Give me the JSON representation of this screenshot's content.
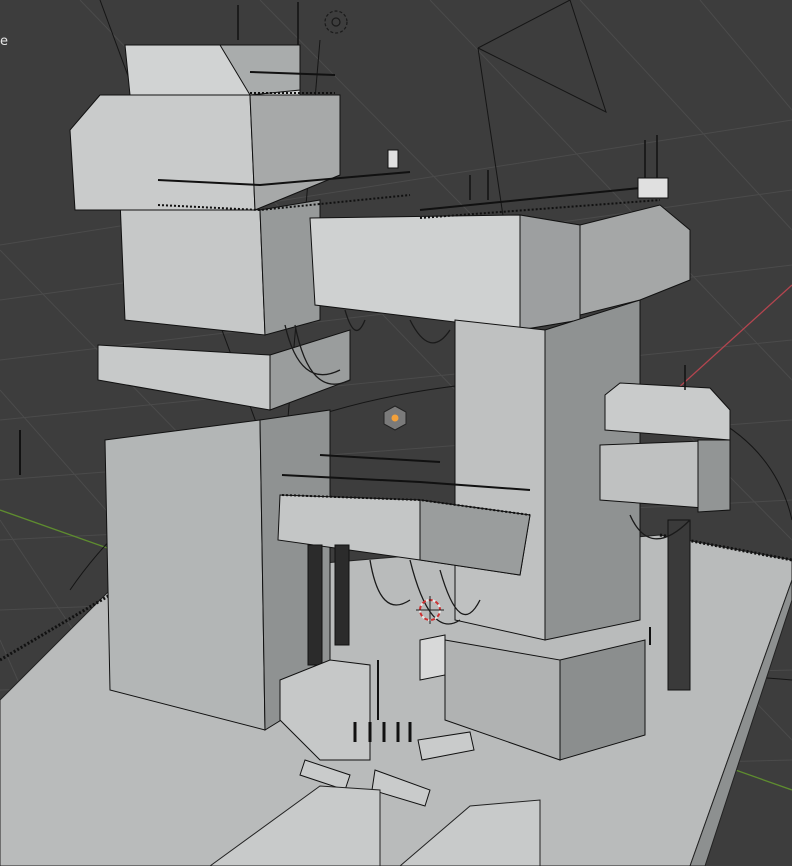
{
  "viewport": {
    "overlay_text": "e",
    "mode": "solid-wireframe",
    "colors": {
      "background": "#3d3d3d",
      "grid_line": "#4a4a4a",
      "x_axis": "#b3454f",
      "y_axis": "#5e8c2f",
      "model_light": "#c9cbcb",
      "model_mid": "#a7a9a9",
      "model_dark": "#7f8282",
      "wire": "#111111",
      "ground": "#b9bbbb",
      "origin_dot": "#f2a03a"
    },
    "icons": [
      "light-icon",
      "object-origin-icon",
      "3d-cursor-icon",
      "camera-frustum"
    ]
  }
}
